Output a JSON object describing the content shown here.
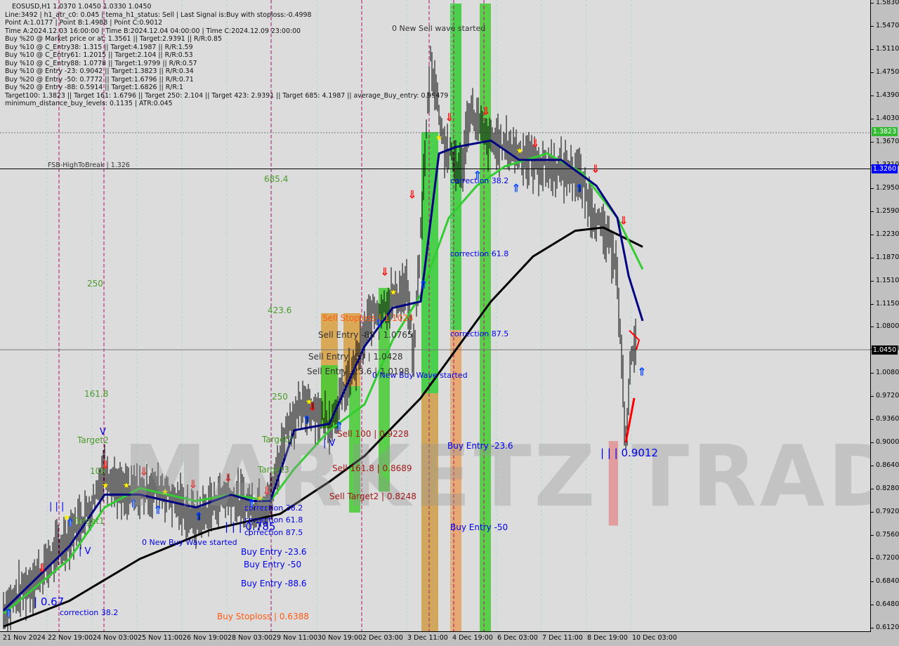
{
  "header": {
    "symbol_line": "EOSUSD,H1  1.0370 1.0450 1.0330 1.0450",
    "lines": [
      "Line:3492 | h1_atr_c0: 0.045 | tema_h1_status: Sell | Last Signal is:Buy with stoploss:-0.4998",
      "Point A:1.0177 | Point B:1.4988 | Point C:0.9012",
      "Time A:2024.12.03 16:00:00 | Time B:2024.12.04 04:00:00 | Time C:2024.12.09 23:00:00",
      "Buy %20 @ Market price or at: 1.3561 || Target:2.9391 || R/R:0.85",
      "Buy %10 @ C_Entry38: 1.315 || Target:4.1987 || R/R:1.59",
      "Buy %10 @ C_Entry61: 1.2015 || Target:2.104 || R/R:0.53",
      "Buy %10 @ C_Entry88: 1.0778 || Target:1.9799 || R/R:0.57",
      "Buy %10 @ Entry -23: 0.9042 || Target:1.3823 || R/R:0.34",
      "Buy %20 @ Entry -50: 0.7772 || Target:1.6796 || R/R:0.71",
      "Buy %20 @ Entry -88: 0.5914 || Target:1.6826 || R/R:1",
      "Target100: 1.3823 || Target 161: 1.6796 || Target 250: 2.104 || Target 423: 2.9391 || Target 685: 4.1987 || average_Buy_entry: 0.99479",
      "minimum_distance_buy_levels: 0.1135 | ATR:0.045"
    ]
  },
  "watermark": "MARKETZ|TRADE",
  "annotations": {
    "new_sell_wave": "0 New Sell wave started",
    "fsb": "FSB-HighToBreak | 1.326",
    "fib_685": "685.4",
    "fib_423": "423.6",
    "fib_250a": "250",
    "fib_250b": "250",
    "fib_161": "161.8",
    "fib_100": "100",
    "target1": "Target1",
    "target2a": "Target2",
    "target2b": "Target2",
    "target3": "Target3",
    "corr382_a": "correction 38.2",
    "corr618_a": "correction 61.8",
    "corr875_a": "correction 87.5",
    "corr382_b": "correction 38.2",
    "corr618_b": "correction 61.8",
    "corr875_b": "correction 87.5",
    "corr382_c": "correction 38.2",
    "buy_wave_a": "0 New Buy Wave started",
    "buy_wave_b": "0 New Buy Wave started",
    "buy_entry_236_a": "Buy Entry -23.6",
    "buy_entry_50_a": "Buy Entry -50",
    "buy_entry_886": "Buy Entry -88.6",
    "buy_entry_236_b": "Buy Entry -23.6",
    "buy_entry_50_b": "Buy Entry -50",
    "buy_stoploss": "Buy Stoploss | 0.6388",
    "sell_stoploss": "Sell Stoploss | 1.1024",
    "sell_entry_88": "Sell Entry -88 | 1.0765",
    "sell_entry_50": "Sell Entry -50 | 1.0428",
    "sell_entry_236": "Sell Entry -23.6 | 1.0198",
    "sell_100": "Sell 100 | 0.9228",
    "sell_1618": "Sell 161.8 | 0.8689",
    "sell_target2": "Sell Target2 | 0.8248",
    "wave_067": "| 0.67",
    "wave_0785": "| | | 0.785",
    "wave_09012": "| | | 0.9012",
    "wave_iii": "| | |",
    "wave_iv_a": "| V",
    "wave_iv_b": "| V",
    "wave_v": "V"
  },
  "chart_data": {
    "type": "candlestick",
    "symbol": "EOSUSD",
    "timeframe": "H1",
    "ohlc_last": {
      "open": 1.037,
      "high": 1.045,
      "low": 1.033,
      "close": 1.045
    },
    "ylim": [
      0.612,
      1.583
    ],
    "y_ticks": [
      "1.5830",
      "1.5470",
      "1.5110",
      "1.4750",
      "1.4390",
      "1.4030",
      "1.3670",
      "1.3310",
      "1.2950",
      "1.2590",
      "1.2230",
      "1.1870",
      "1.1510",
      "1.1150",
      "1.0800",
      "1.0450",
      "1.0080",
      "0.9720",
      "0.9360",
      "0.9000",
      "0.8640",
      "0.8280",
      "0.7920",
      "0.7560",
      "0.7200",
      "0.6840",
      "0.6480",
      "0.6120"
    ],
    "x_ticks": [
      "21 Nov 2024",
      "22 Nov 19:00",
      "24 Nov 03:00",
      "25 Nov 11:00",
      "26 Nov 19:00",
      "28 Nov 03:00",
      "29 Nov 11:00",
      "30 Nov 19:00",
      "2 Dec 03:00",
      "3 Dec 11:00",
      "4 Dec 19:00",
      "6 Dec 03:00",
      "7 Dec 11:00",
      "8 Dec 19:00",
      "10 Dec 03:00"
    ],
    "price_labels": {
      "current": "1.0450",
      "fsb": "1.3260",
      "target": "1.3823"
    },
    "levels": {
      "fsb_high_to_break": 1.326,
      "target100": 1.3823,
      "current": 1.045
    },
    "colors": {
      "ma_long": "#000000",
      "tema": "#000080",
      "ma_mid": "#33cc33",
      "candles": "#000000",
      "stops": "#ff4500",
      "fsb_box": "#0000ff",
      "target_box": "#33bb33"
    },
    "price_path": [
      [
        "2024-11-21T12:00",
        0.64
      ],
      [
        "2024-11-22T15:00",
        0.7
      ],
      [
        "2024-11-24T02:00",
        0.8
      ],
      [
        "2024-11-24T12:00",
        0.86
      ],
      [
        "2024-11-25T01:00",
        0.82
      ],
      [
        "2024-11-26T04:00",
        0.83
      ],
      [
        "2024-11-27T05:00",
        0.78
      ],
      [
        "2024-11-28T01:00",
        0.82
      ],
      [
        "2024-11-28T21:00",
        0.8
      ],
      [
        "2024-11-29T10:00",
        0.81
      ],
      [
        "2024-11-29T22:00",
        0.93
      ],
      [
        "2024-11-30T13:00",
        0.96
      ],
      [
        "2024-12-01T04:00",
        0.93
      ],
      [
        "2024-12-01T19:00",
        1.0
      ],
      [
        "2024-12-02T10:00",
        1.1
      ],
      [
        "2024-12-03T11:00",
        1.14
      ],
      [
        "2024-12-03T16:00",
        1.03
      ],
      [
        "2024-12-04T04:00",
        1.5
      ],
      [
        "2024-12-04T14:00",
        1.36
      ],
      [
        "2024-12-05T02:00",
        1.32
      ],
      [
        "2024-12-05T08:00",
        1.42
      ],
      [
        "2024-12-05T20:00",
        1.37
      ],
      [
        "2024-12-06T12:00",
        1.36
      ],
      [
        "2024-12-07T12:00",
        1.33
      ],
      [
        "2024-12-08T12:00",
        1.32
      ],
      [
        "2024-12-09T06:00",
        1.23
      ],
      [
        "2024-12-09T16:00",
        1.19
      ],
      [
        "2024-12-09T23:00",
        0.9012
      ],
      [
        "2024-12-10T03:00",
        1.04
      ],
      [
        "2024-12-10T06:00",
        1.045
      ]
    ],
    "series": [
      {
        "key": "ma_long",
        "points": [
          [
            "2024-11-21T12:00",
            0.615
          ],
          [
            "2024-11-23T11:00",
            0.655
          ],
          [
            "2024-11-25T13:00",
            0.72
          ],
          [
            "2024-11-27T15:00",
            0.765
          ],
          [
            "2024-11-29T17:00",
            0.79
          ],
          [
            "2024-12-01T04:00",
            0.84
          ],
          [
            "2024-12-02T05:00",
            0.88
          ],
          [
            "2024-12-03T21:00",
            0.97
          ],
          [
            "2024-12-04T17:00",
            1.03
          ],
          [
            "2024-12-05T23:00",
            1.12
          ],
          [
            "2024-12-07T05:00",
            1.19
          ],
          [
            "2024-12-08T11:00",
            1.23
          ],
          [
            "2024-12-09T07:00",
            1.235
          ],
          [
            "2024-12-10T11:00",
            1.205
          ]
        ]
      },
      {
        "key": "ma_mid",
        "points": [
          [
            "2024-11-21T12:00",
            0.635
          ],
          [
            "2024-11-23T11:00",
            0.72
          ],
          [
            "2024-11-24T12:00",
            0.8
          ],
          [
            "2024-11-25T13:00",
            0.83
          ],
          [
            "2024-11-27T05:00",
            0.81
          ],
          [
            "2024-11-28T06:00",
            0.82
          ],
          [
            "2024-11-29T10:00",
            0.81
          ],
          [
            "2024-11-30T03:00",
            0.86
          ],
          [
            "2024-12-01T04:00",
            0.92
          ],
          [
            "2024-12-02T05:00",
            0.96
          ],
          [
            "2024-12-03T01:00",
            1.06
          ],
          [
            "2024-12-03T21:00",
            1.13
          ],
          [
            "2024-12-04T17:00",
            1.25
          ],
          [
            "2024-12-05T13:00",
            1.3
          ],
          [
            "2024-12-06T09:00",
            1.33
          ],
          [
            "2024-12-07T15:00",
            1.35
          ],
          [
            "2024-12-08T16:00",
            1.32
          ],
          [
            "2024-12-09T17:00",
            1.25
          ],
          [
            "2024-12-10T11:00",
            1.17
          ]
        ]
      },
      {
        "key": "tema",
        "points": [
          [
            "2024-11-21T12:00",
            0.64
          ],
          [
            "2024-11-23T11:00",
            0.74
          ],
          [
            "2024-11-24T12:00",
            0.82
          ],
          [
            "2024-11-25T13:00",
            0.82
          ],
          [
            "2024-11-27T05:00",
            0.8
          ],
          [
            "2024-11-28T06:00",
            0.82
          ],
          [
            "2024-11-28T21:00",
            0.81
          ],
          [
            "2024-11-29T10:00",
            0.81
          ],
          [
            "2024-11-30T03:00",
            0.92
          ],
          [
            "2024-12-01T04:00",
            0.93
          ],
          [
            "2024-12-02T05:00",
            1.05
          ],
          [
            "2024-12-03T01:00",
            1.11
          ],
          [
            "2024-12-03T21:00",
            1.12
          ],
          [
            "2024-12-04T10:00",
            1.35
          ],
          [
            "2024-12-04T22:00",
            1.36
          ],
          [
            "2024-12-05T23:00",
            1.37
          ],
          [
            "2024-12-06T19:00",
            1.34
          ],
          [
            "2024-12-08T01:00",
            1.34
          ],
          [
            "2024-12-09T02:00",
            1.3
          ],
          [
            "2024-12-09T17:00",
            1.25
          ],
          [
            "2024-12-10T01:00",
            1.16
          ],
          [
            "2024-12-10T11:00",
            1.09
          ]
        ]
      }
    ]
  }
}
